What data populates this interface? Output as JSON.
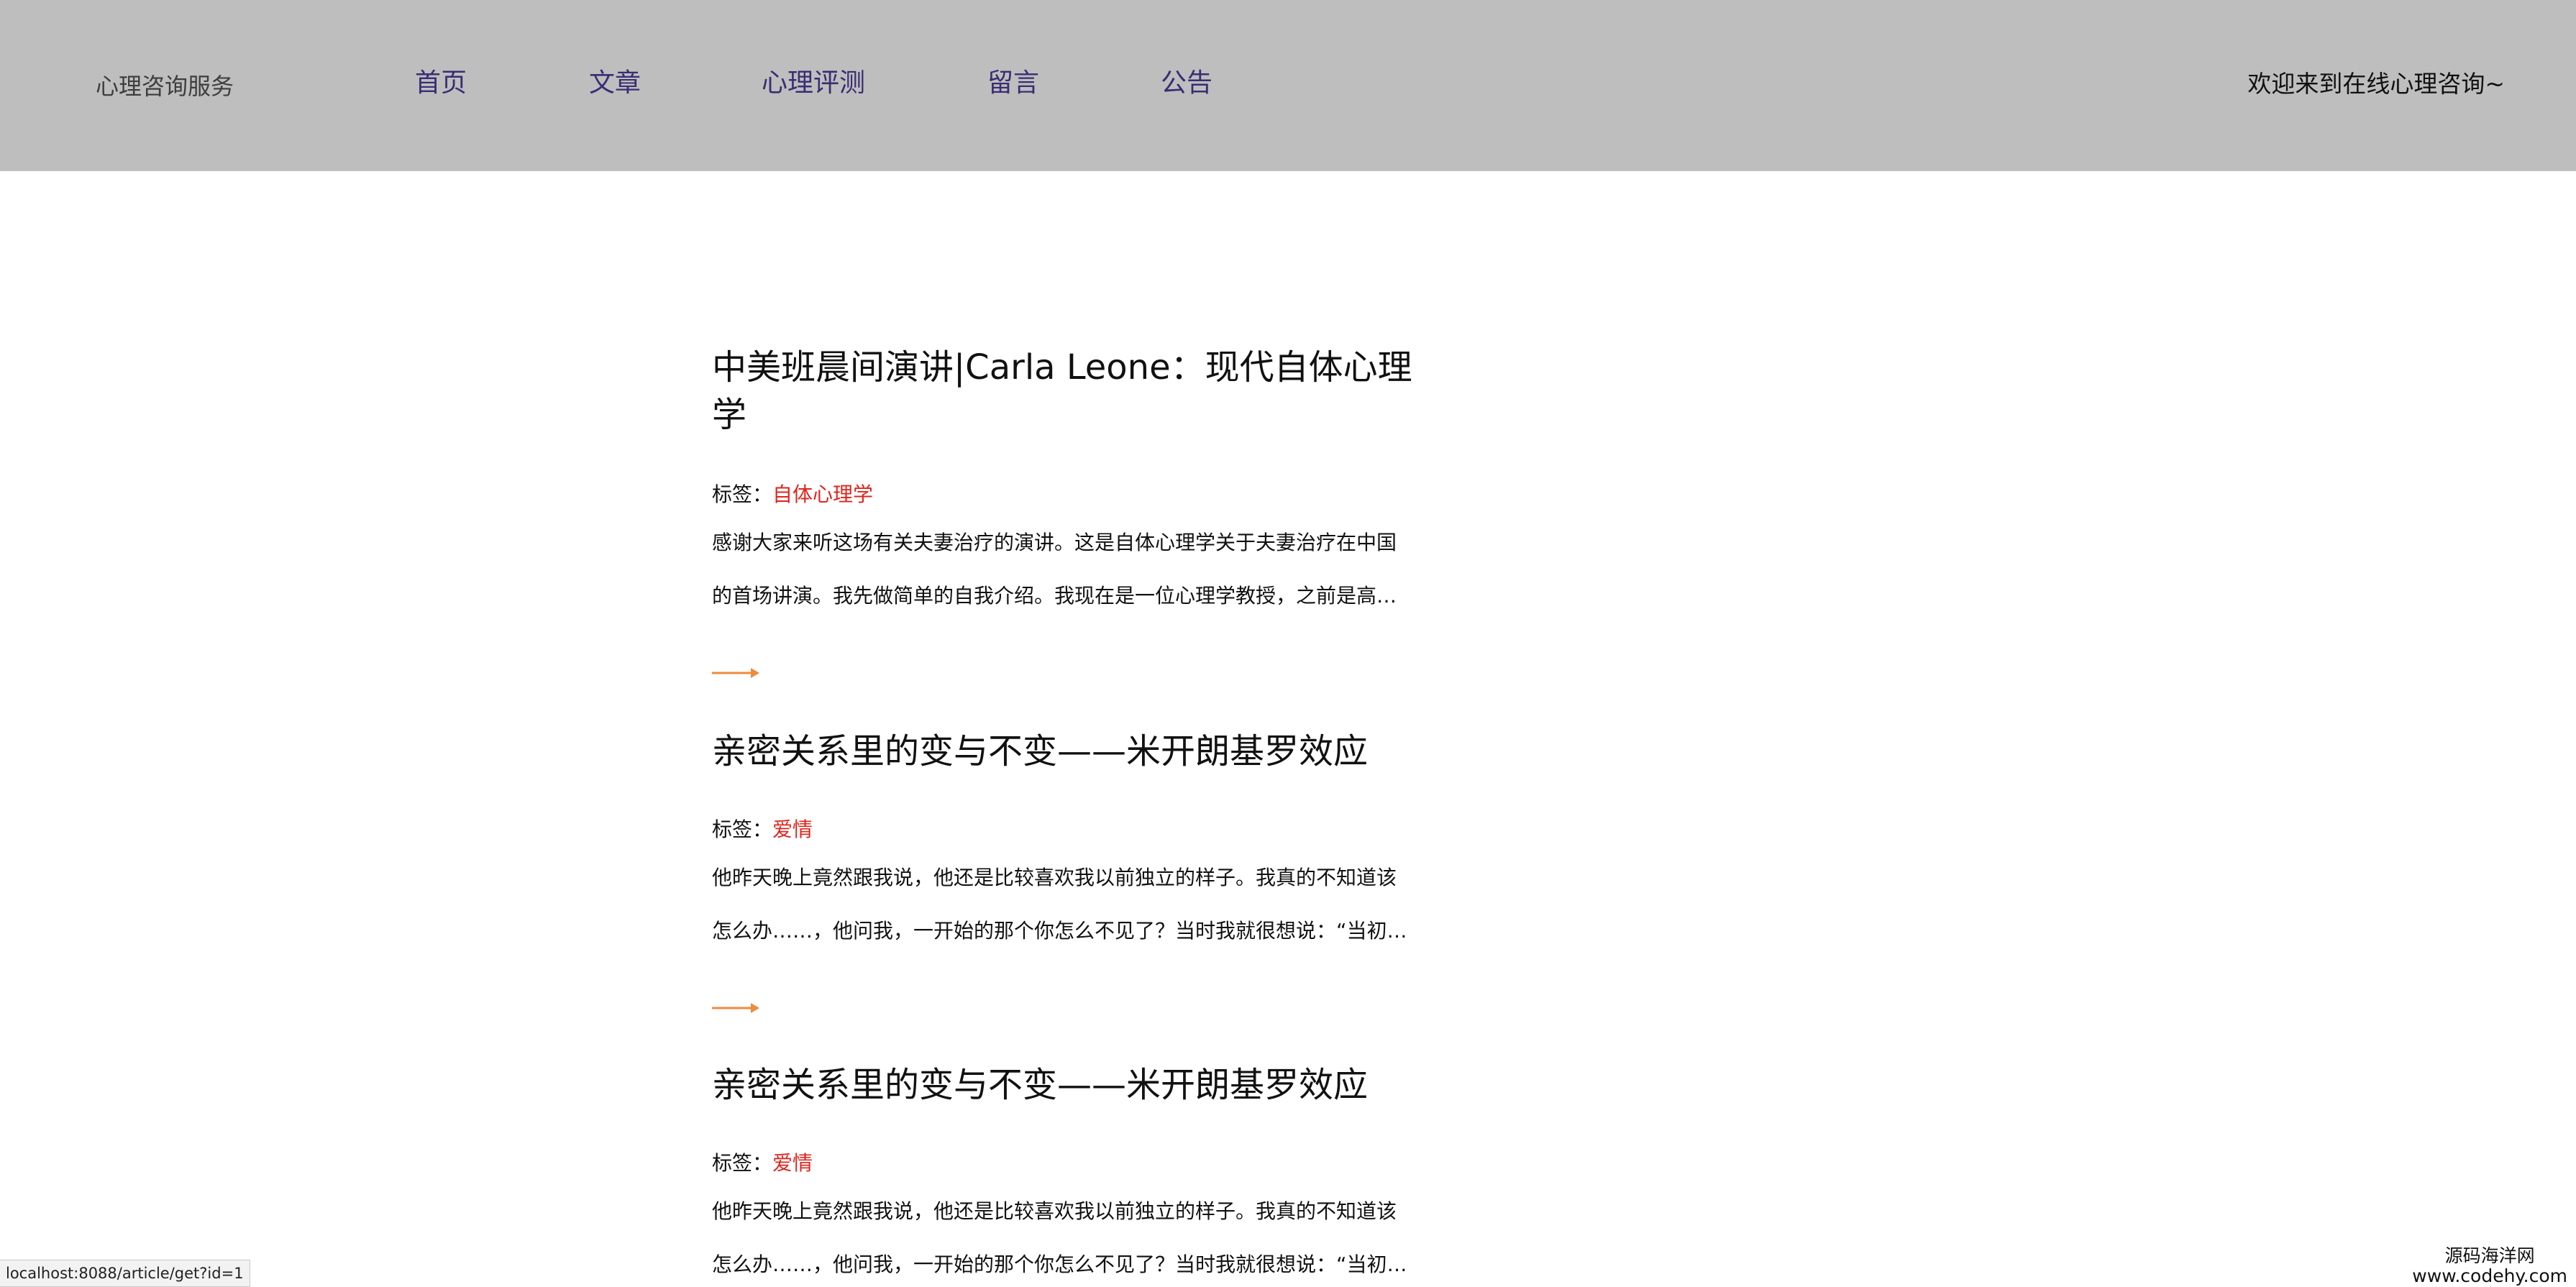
{
  "header": {
    "brand": "心理咨询服务",
    "nav": [
      "首页",
      "文章",
      "心理评测",
      "留言",
      "公告"
    ],
    "welcome": "欢迎来到在线心理咨询~"
  },
  "articles": [
    {
      "title": "中美班晨间演讲|Carla Leone：现代自体心理学",
      "tag_label": "标签：",
      "tag": "自体心理学",
      "summary_line1": "感谢大家来听这场有关夫妻治疗的演讲。这是自体心理学关于夫妻治疗在中国",
      "summary_line2": "的首场讲演。我先做简单的自我介绍。我现在是一位心理学教授，之前是高…"
    },
    {
      "title": "亲密关系里的变与不变——米开朗基罗效应",
      "tag_label": "标签：",
      "tag": "爱情",
      "summary_line1": "他昨天晚上竟然跟我说，他还是比较喜欢我以前独立的样子。我真的不知道该",
      "summary_line2": "怎么办……，他问我，一开始的那个你怎么不见了？当时我就很想说：“当初…"
    },
    {
      "title": "亲密关系里的变与不变——米开朗基罗效应",
      "tag_label": "标签：",
      "tag": "爱情",
      "summary_line1": "他昨天晚上竟然跟我说，他还是比较喜欢我以前独立的样子。我真的不知道该",
      "summary_line2": "怎么办……，他问我，一开始的那个你怎么不见了？当时我就很想说：“当初…"
    }
  ],
  "status_url": "localhost:8088/article/get?id=1",
  "watermark": {
    "line1": "源码海洋网",
    "line2": "www.codehy.com"
  },
  "colors": {
    "header_bg": "#bebebe",
    "nav_text": "#3a2d73",
    "tag_text": "#e0241d",
    "arrow": "#f08a3c"
  },
  "icons": {
    "read_more": "arrow-right-icon"
  }
}
